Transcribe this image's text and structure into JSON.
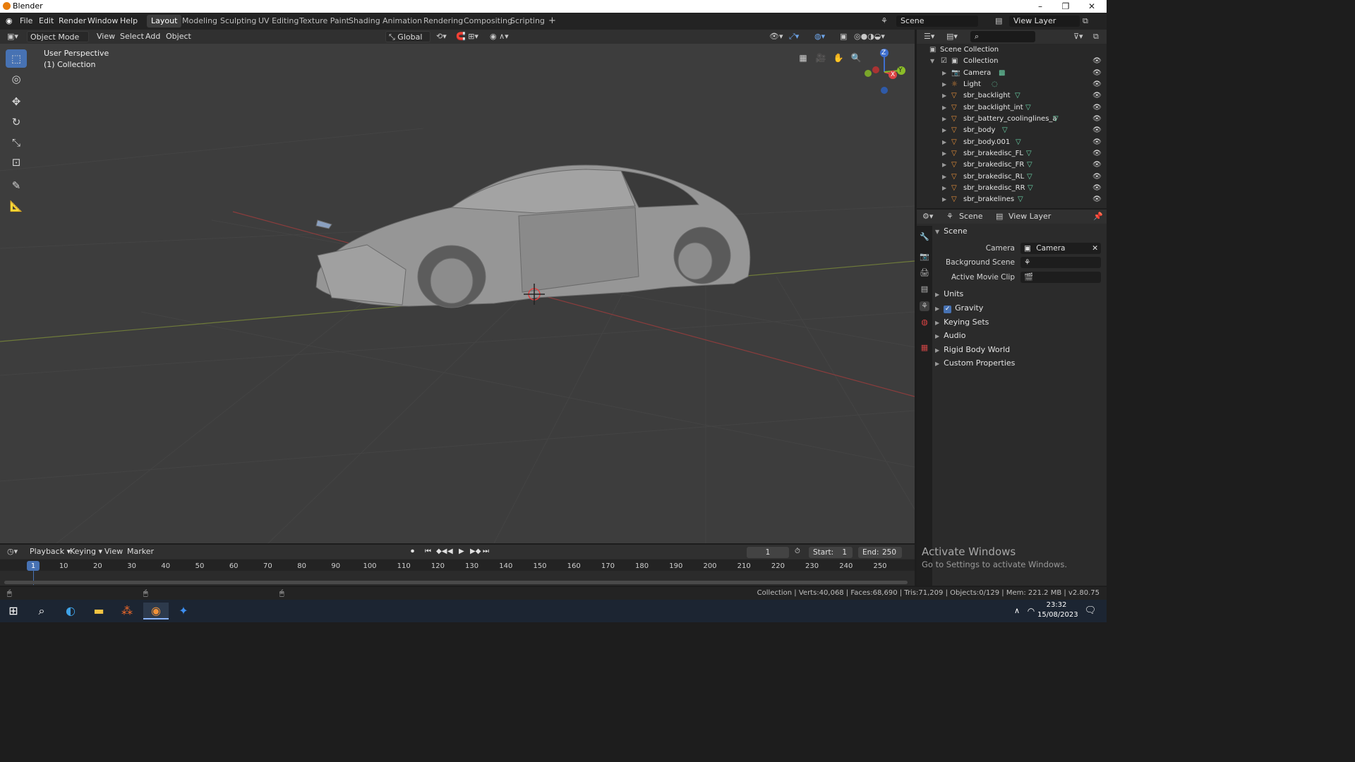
{
  "window": {
    "title": "Blender",
    "buttons": [
      "–",
      "❐",
      "✕"
    ]
  },
  "menu": [
    "File",
    "Edit",
    "Render",
    "Window",
    "Help"
  ],
  "workspaces": [
    "Layout",
    "Modeling",
    "Sculpting",
    "UV Editing",
    "Texture Paint",
    "Shading",
    "Animation",
    "Rendering",
    "Compositing",
    "Scripting"
  ],
  "workspace_add": "+",
  "scene_field": "Scene",
  "view_layer_field": "View Layer",
  "viewport_header": {
    "mode": "Object Mode",
    "view": "View",
    "select": "Select",
    "add": "Add",
    "object": "Object",
    "orientation": "Global"
  },
  "viewport": {
    "perspective": "User Perspective",
    "collection": "(1) Collection"
  },
  "gizmo": {
    "z": "Z",
    "x": "X",
    "y": "Y"
  },
  "outliner": {
    "root": "Scene Collection",
    "collection": "Collection",
    "items": [
      "Camera",
      "Light",
      "sbr_backlight",
      "sbr_backlight_int",
      "sbr_battery_coolinglines_a",
      "sbr_body",
      "sbr_body.001",
      "sbr_brakedisc_FL",
      "sbr_brakedisc_FR",
      "sbr_brakedisc_RL",
      "sbr_brakedisc_RR",
      "sbr_brakelines"
    ]
  },
  "properties": {
    "tab_scene": "Scene",
    "tab_view_layer": "View Layer",
    "section": "Scene",
    "camera_label": "Camera",
    "camera_value": "Camera",
    "background_scene_label": "Background Scene",
    "active_movie_clip_label": "Active Movie Clip",
    "panels": [
      "Units",
      "Gravity",
      "Keying Sets",
      "Audio",
      "Rigid Body World",
      "Custom Properties"
    ]
  },
  "timeline": {
    "menus": [
      "Playback",
      "Keying",
      "View",
      "Marker"
    ],
    "current_frame": "1",
    "start_label": "Start:",
    "start": "1",
    "end_label": "End:",
    "end": "250",
    "ticks": [
      "1",
      "10",
      "20",
      "30",
      "40",
      "50",
      "60",
      "70",
      "80",
      "90",
      "100",
      "110",
      "120",
      "130",
      "140",
      "150",
      "160",
      "170",
      "180",
      "190",
      "200",
      "210",
      "220",
      "230",
      "240",
      "250"
    ]
  },
  "status": "Collection | Verts:40,068 | Faces:68,690 | Tris:71,209 | Objects:0/129 | Mem: 221.2 MB | v2.80.75",
  "activate": {
    "line1": "Activate Windows",
    "line2": "Go to Settings to activate Windows."
  },
  "clock": {
    "time": "23:32",
    "date": "15/08/2023"
  }
}
